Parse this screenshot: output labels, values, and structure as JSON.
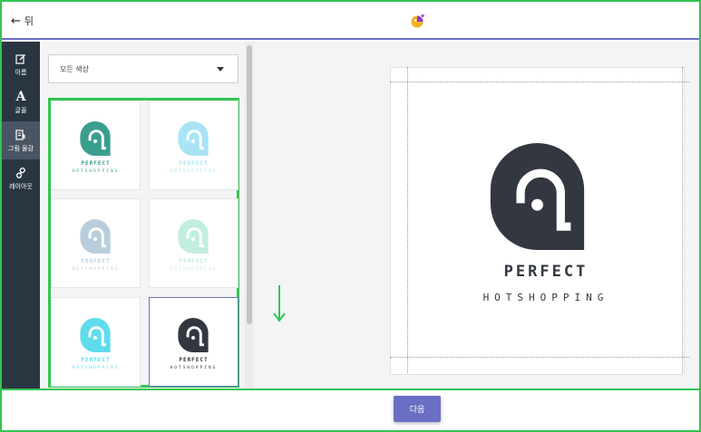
{
  "header": {
    "back_label": "뒤"
  },
  "sidebar": {
    "items": [
      {
        "label": "이름",
        "icon": "edit-icon"
      },
      {
        "label": "글꼴",
        "icon": "font-a-icon"
      },
      {
        "label": "그림 물감",
        "icon": "paint-icon",
        "active": true
      },
      {
        "label": "레이아웃",
        "icon": "link-icon"
      }
    ]
  },
  "panel": {
    "filter_select": {
      "value": "모든 색상"
    },
    "swatches": [
      {
        "name": "PERFECT",
        "tagline": "HOTSHOPPING",
        "mark": "#3a9e8e",
        "name_color": "#3a9e8e",
        "tag_color": "#3a9e8e"
      },
      {
        "name": "PERFECT",
        "tagline": "HOTSHOPPING",
        "mark": "#a9e4f5",
        "name_color": "#a9e4f5",
        "tag_color": "#a9e4f5"
      },
      {
        "name": "PERFECT",
        "tagline": "HOTSHOPPING",
        "mark": "#b9cedd",
        "name_color": "#b9cedd",
        "tag_color": "#b9cedd"
      },
      {
        "name": "PERFECT",
        "tagline": "HOTSHOPPING",
        "mark": "#c2eee0",
        "name_color": "#c2eee0",
        "tag_color": "#c2eee0"
      },
      {
        "name": "PERFECT",
        "tagline": "HOTSHOPPING",
        "mark": "#5fdcec",
        "name_color": "#5fdcec",
        "tag_color": "#5fdcec"
      },
      {
        "name": "PERFECT",
        "tagline": "HOTSHOPPING",
        "mark": "#333740",
        "name_color": "#333740",
        "tag_color": "#333740",
        "selected": true
      }
    ]
  },
  "preview": {
    "name": "PERFECT",
    "tagline": "HOTSHOPPING",
    "mark_color": "#333740"
  },
  "footer": {
    "next_label": "다음"
  },
  "colors": {
    "accent": "#6b6fc4",
    "highlight": "#33c553",
    "sidebar_bg": "#2a3542"
  }
}
